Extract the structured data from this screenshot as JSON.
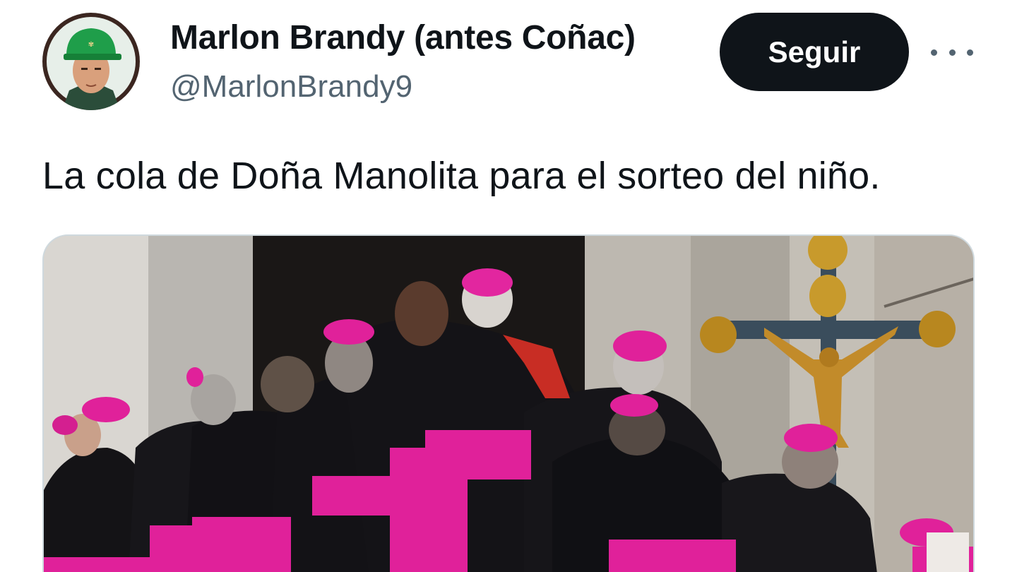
{
  "tweet": {
    "author_name": "Marlon Brandy (antes Coñac)",
    "author_handle": "@MarlonBrandy9",
    "follow_label": "Seguir",
    "text": "La cola de Doña Manolita para el sorteo del niño."
  },
  "icons": {
    "more": "more-horizontal-icon"
  },
  "colors": {
    "follow_button_bg": "#0f1419",
    "follow_button_text": "#ffffff",
    "handle_text": "#536471",
    "media_border": "#cfd9de",
    "magenta": "#e0219a"
  }
}
